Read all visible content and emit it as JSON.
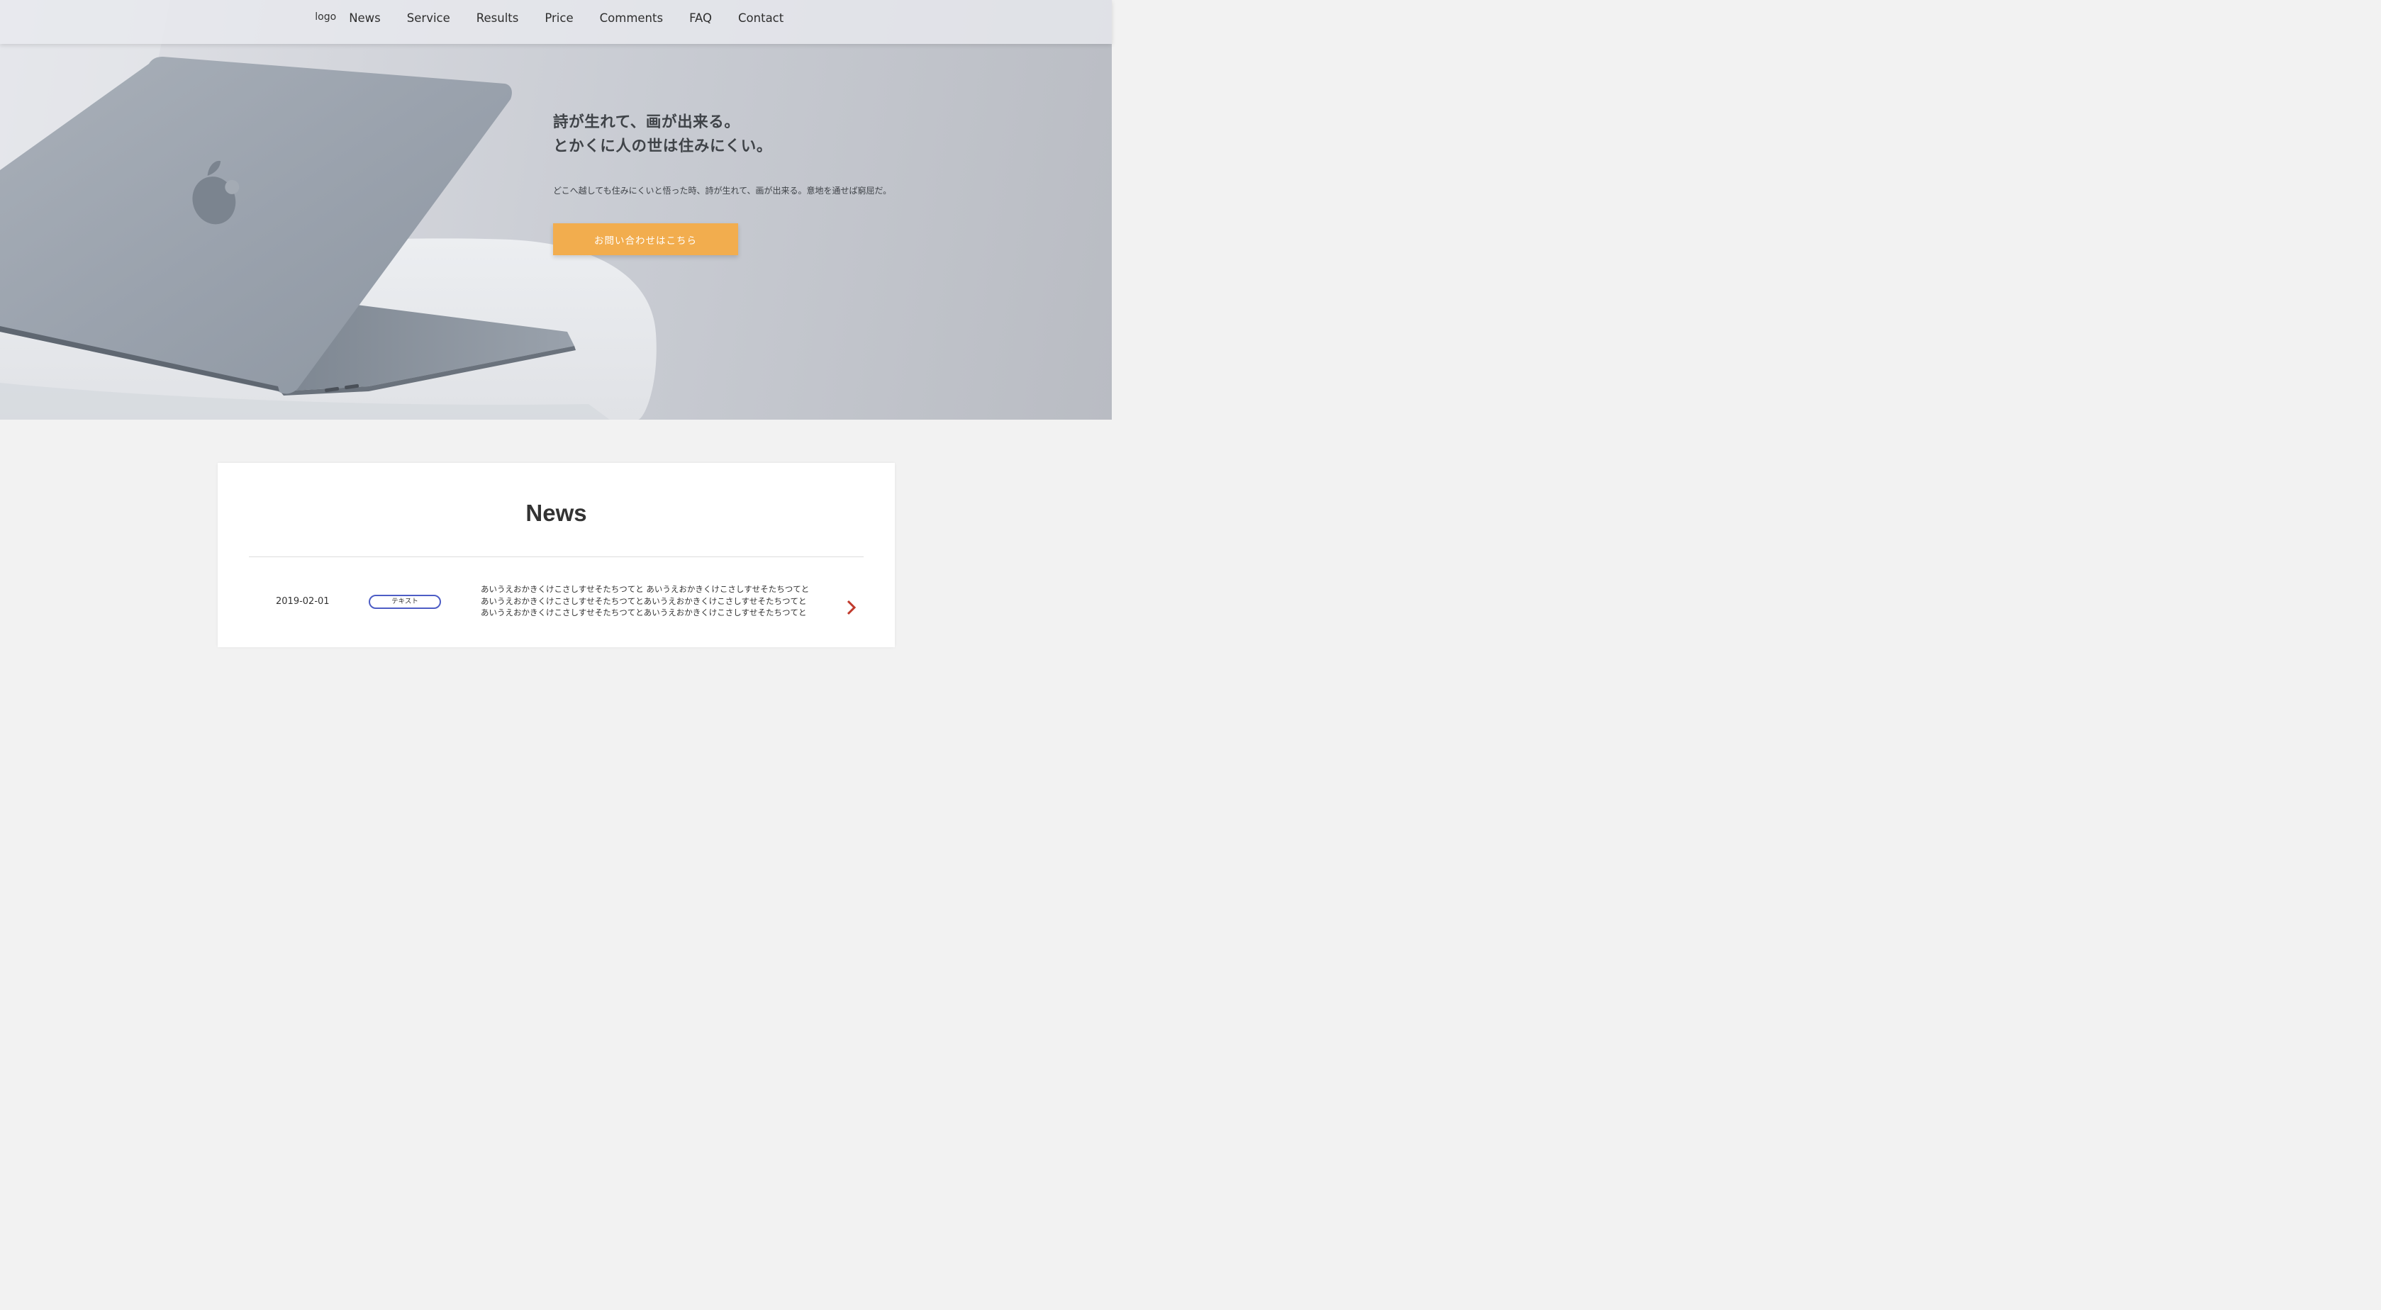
{
  "header": {
    "logo": "logo",
    "nav": [
      "News",
      "Service",
      "Results",
      "Price",
      "Comments",
      "FAQ",
      "Contact"
    ]
  },
  "hero": {
    "title_lines": [
      "詩が生れて、画が出来る。",
      "とかくに人の世は住みにくい。"
    ],
    "subtitle": "どこへ越しても住みにくいと悟った時、詩が生れて、画が出来る。意地を通せば窮屈だ。",
    "cta_label": "お問い合わせはこちら"
  },
  "news": {
    "title": "News",
    "items": [
      {
        "date": "2019-02-01",
        "tag": "テキスト",
        "text_lines": [
          "あいうえおかきくけこさしすせそたちつてと あいうえおかきくけこさしすせそたちつてと",
          "あいうえおかきくけこさしすせそたちつてとあいうえおかきくけこさしすせそたちつてと",
          "あいうえおかきくけこさしすせそたちつてとあいうえおかきくけこさしすせそたちつてと"
        ]
      }
    ]
  },
  "colors": {
    "cta": "#f2ad4e",
    "tag_border": "#4d5dc5",
    "arrow": "#c0392b",
    "page_bg": "#f2f2f2"
  },
  "icons": {
    "news_item_arrow": "chevron-right-icon"
  }
}
